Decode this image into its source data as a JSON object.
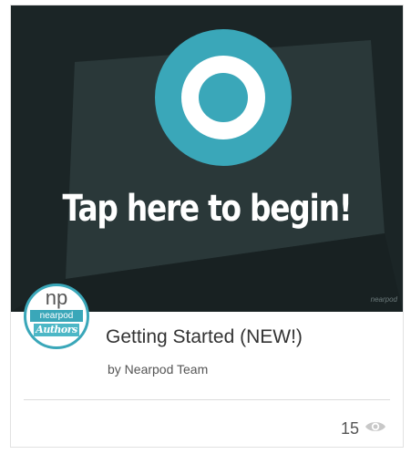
{
  "card": {
    "thumbnail": {
      "headline": "Tap here to begin!",
      "watermark": "nearpod",
      "icon": "target-icon",
      "colors": {
        "background": "#1f2b2c",
        "target_outer": "#3aa7b9",
        "target_inner": "#ffffff"
      }
    },
    "badge": {
      "logo_text": "np",
      "brand": "nearpod",
      "label": "Authors",
      "accent": "#3aa7b9"
    },
    "title": "Getting Started (NEW!)",
    "author": "by Nearpod Team",
    "stats": {
      "views": "15",
      "views_icon": "eye-icon"
    }
  }
}
